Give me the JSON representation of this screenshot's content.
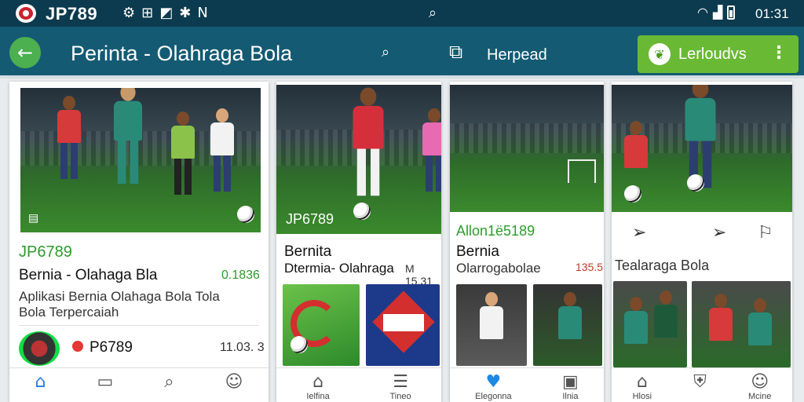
{
  "status_bar": {
    "brand": "JP789",
    "time": "01:31",
    "icons": [
      "settings-icon",
      "data-icon",
      "sim-icon",
      "bluetooth-icon",
      "nfc-icon"
    ],
    "search_icon": "search-icon"
  },
  "header": {
    "title": "Perinta - Olahraga Bola",
    "link_label": "Herpead",
    "download_label": "Lerloudvs"
  },
  "colors": {
    "status_bar": "#0c3a4e",
    "header": "#145a73",
    "accent_green": "#6ab934",
    "back_button": "#4caf50",
    "link_green": "#2e9a2e"
  },
  "cards": [
    {
      "code": "JP6789",
      "title": "Bernia - Olahaga Bla",
      "value": "0.1836",
      "description": "Aplikasi Bernia Olahaga Bola Tola Bola Terpercaiah",
      "row_code": "P6789",
      "row_value": "11.03. 3",
      "nav": [
        "home-icon",
        "tab-icon",
        "search-icon",
        "profile-icon"
      ]
    },
    {
      "hero_label": "JP6789",
      "title_line1": "Bernita",
      "title_line2": "Dtermia- Olahraga",
      "value": "M 15.31",
      "nav": [
        {
          "icon": "home-icon",
          "label": "Ielfina"
        },
        {
          "icon": "menu-icon",
          "label": "Tineo"
        }
      ]
    },
    {
      "code": "Allon1ё5189",
      "title_line1": "Bernia",
      "title_line2": "Olarrogabolae",
      "value": "135.5",
      "nav": [
        {
          "icon": "heart-icon",
          "label": "Elegonna"
        },
        {
          "icon": "image-icon",
          "label": "Ilnia"
        }
      ]
    },
    {
      "title": "Tealaraga Bola",
      "actions": [
        "send-icon",
        "send-icon",
        "chat-icon"
      ],
      "nav": [
        {
          "icon": "home-icon",
          "label": "Hlosi"
        },
        {
          "icon": "shield-icon",
          "label": ""
        },
        {
          "icon": "profile-icon",
          "label": "Mcine"
        }
      ]
    }
  ]
}
